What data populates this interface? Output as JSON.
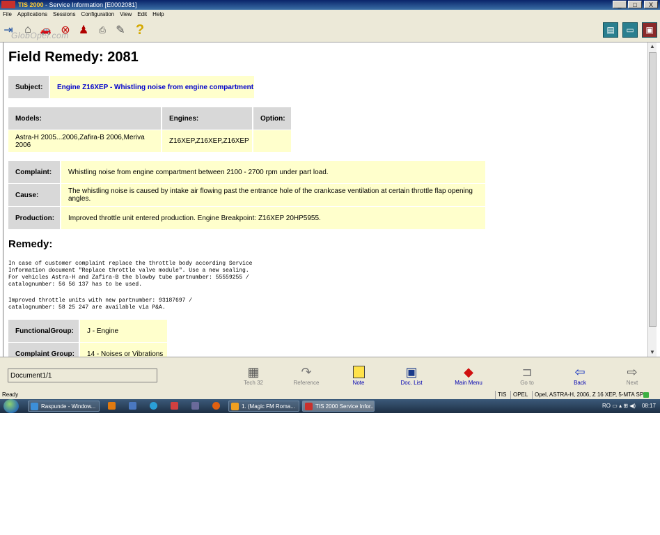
{
  "window": {
    "app_name": "TIS 2000",
    "title_rest": " - Service Information [E0002081]",
    "btn_min": "_",
    "btn_max": "□",
    "btn_close": "X"
  },
  "menu": [
    "File",
    "Applications",
    "Sessions",
    "Configuration",
    "View",
    "Edit",
    "Help"
  ],
  "watermark": "GlobOpel.com",
  "document": {
    "heading": "Field Remedy: 2081",
    "subject_label": "Subject:",
    "subject_value": "Engine Z16XEP - Whistling noise from engine compartment",
    "models_label": "Models:",
    "engines_label": "Engines:",
    "option_label": "Option:",
    "models_value": "Astra-H 2005...2006,Zafira-B 2006,Meriva 2006",
    "engines_value": "Z16XEP,Z16XEP,Z16XEP",
    "option_value": "",
    "complaint_label": "Complaint:",
    "complaint_value": "Whistling noise from engine compartment between 2100 - 2700 rpm under part load.",
    "cause_label": "Cause:",
    "cause_value": "The whistling noise is caused by intake air flowing past the entrance hole of the crankcase ventilation at certain throttle flap opening angles.",
    "production_label": "Production:",
    "production_value": "Improved throttle unit entered production. Engine Breakpoint: Z16XEP 20HP5955.",
    "remedy_heading": "Remedy:",
    "remedy_para1": "In case of customer complaint replace the throttle body according Service\nInformation document \"Replace throttle valve module\". Use a new sealing.\nFor vehicles Astra-H and Zafira-B the blowby tube partnumber: 55559255 /\ncatalognumber: 56 56 137 has to be used.",
    "remedy_para2": "Improved throttle units with new partnumber: 93187697 /\ncatalognumber: 58 25 247 are available via P&A.",
    "functional_group_label": "FunctionalGroup:",
    "functional_group_value": "J - Engine",
    "complaint_group_label": "Complaint Group:",
    "complaint_group_value": "14 - Noises or Vibrations"
  },
  "bottom": {
    "document_field": "Document1/1",
    "nav": [
      {
        "label": "Tech 32",
        "enabled": false
      },
      {
        "label": "Reference",
        "enabled": false
      },
      {
        "label": "Note",
        "enabled": true
      },
      {
        "label": "Doc. List",
        "enabled": true
      },
      {
        "label": "Main Menu",
        "enabled": true
      },
      {
        "label": "Go to",
        "enabled": false
      },
      {
        "label": "Back",
        "enabled": true
      },
      {
        "label": "Next",
        "enabled": false
      }
    ]
  },
  "status": {
    "left": "Ready",
    "tis": "TIS",
    "brand": "OPEL",
    "vehicle": "Opel, ASTRA-H, 2006, Z 16 XEP, 5-MTA SP"
  },
  "taskbar": {
    "task1": "Raspunde - Window...",
    "task2": "1. (Magic FM Roma...",
    "task3": "TIS 2000 Service Infor...",
    "lang": "RO",
    "clock": "08:17"
  }
}
